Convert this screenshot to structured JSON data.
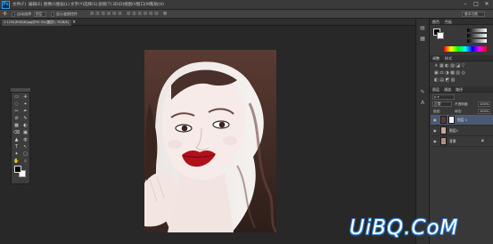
{
  "app": {
    "logo": "Ps"
  },
  "menubar": {
    "items": [
      "文件(F)",
      "编辑(E)",
      "图像(I)",
      "图层(L)",
      "文字(Y)",
      "选择(S)",
      "滤镜(T)",
      "3D(D)",
      "视图(V)",
      "窗口(W)",
      "帮助(H)"
    ],
    "window_controls": [
      "–",
      "□",
      "✕"
    ]
  },
  "options_bar": {
    "auto_select_label": "自动选择",
    "layer_dropdown": "图层",
    "show_transform_label": "显示变换控件",
    "workspace": "基本功能"
  },
  "document": {
    "tab_label": "1·1234(RGB/8)jpg@50.3%(图层1, RGB/8)",
    "close_icon": "×"
  },
  "toolbox": {
    "tools": [
      "▭",
      "✢",
      "◌",
      "⌖",
      "✂",
      "✒",
      "⊘",
      "✎",
      "▩",
      "◐",
      "⌫",
      "▣",
      "▲",
      "◍",
      "T",
      "↖",
      "✦",
      "▢",
      "✋",
      "⌕"
    ]
  },
  "panels": {
    "color_tabs": [
      "颜色",
      "色板"
    ],
    "adjust_tabs": [
      "调整",
      "样式"
    ],
    "layers_tabs": [
      "图层",
      "通道",
      "路径"
    ],
    "blend_mode": "正常",
    "opacity_label": "不透明度:",
    "opacity_value": "100%",
    "lock_label": "锁定:",
    "fill_label": "填充:",
    "fill_value": "100%",
    "layers": [
      {
        "name": "图层 1",
        "selected": true
      },
      {
        "name": "图层1",
        "selected": false
      },
      {
        "name": "背景",
        "selected": false
      }
    ]
  },
  "watermark": "UiBQ.CoM",
  "colors": {
    "accent": "#2c7dd2",
    "lips": "#b0101c"
  }
}
